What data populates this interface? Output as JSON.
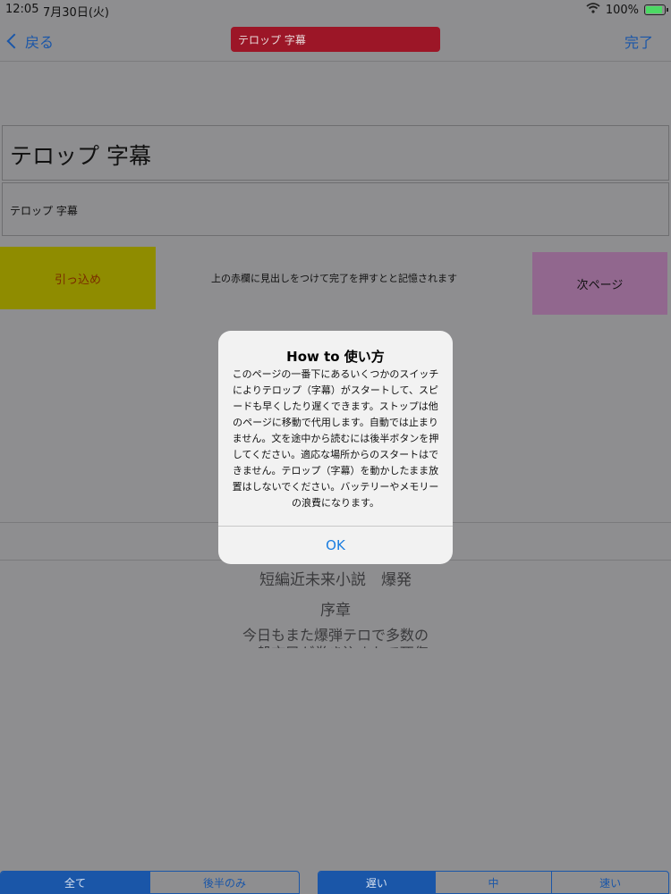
{
  "status_bar": {
    "time": "12:05",
    "date": "7月30日(火)",
    "battery": "100%"
  },
  "nav": {
    "back_label": "戻る",
    "title_field_value": "テロップ 字幕",
    "done_label": "完了"
  },
  "fields": {
    "heading": "テロップ 字幕",
    "subtitle": "テロップ 字幕"
  },
  "buttons": {
    "retract_label": "引っ込め",
    "next_page_label": "次ページ"
  },
  "hint_text": "上の赤欄に見出しをつけて完了を押すとと記憶されます",
  "story": {
    "title": "短編近未来小説　爆発",
    "chapter": "序章",
    "line1": "今日もまた爆弾テロで多数の",
    "line2": "一般市民が巻き込まれて死傷"
  },
  "alert": {
    "title": "How to 使い方",
    "message": "このページの一番下にあるいくつかのスイッチによりテロップ（字幕）がスタートして、スピードも早くしたり遅くできます。ストップは他のページに移動で代用します。自動では止まりません。文を途中から読むには後半ボタンを押してください。適応な場所からのスタートはできません。テロップ（字幕）を動かしたまま放置はしないでください。バッテリーやメモリーの浪費になります。",
    "ok_label": "OK"
  },
  "range_control": {
    "options": [
      "全て",
      "後半のみ"
    ],
    "selected": "全て"
  },
  "speed_control": {
    "options": [
      "遅い",
      "中",
      "速い"
    ],
    "selected": "遅い"
  },
  "colors": {
    "accent": "#1a7de0",
    "title_field": "#9c1627",
    "retract_button": "#8f8c00",
    "next_button": "#91678e",
    "dim_background": "#8e8e90"
  }
}
